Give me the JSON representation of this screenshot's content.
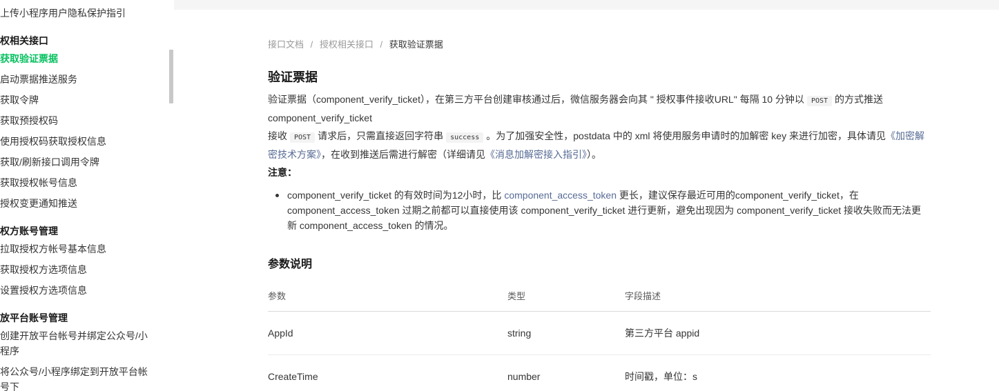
{
  "sidebar": {
    "items": [
      {
        "label": "上传小程序用户隐私保护指引",
        "kind": "item"
      },
      {
        "label": "权相关接口",
        "kind": "head"
      },
      {
        "label": "获取验证票据",
        "kind": "active"
      },
      {
        "label": "启动票据推送服务",
        "kind": "item"
      },
      {
        "label": "获取令牌",
        "kind": "item"
      },
      {
        "label": "获取预授权码",
        "kind": "item"
      },
      {
        "label": "使用授权码获取授权信息",
        "kind": "item"
      },
      {
        "label": "获取/刷新接口调用令牌",
        "kind": "item"
      },
      {
        "label": "获取授权帐号信息",
        "kind": "item"
      },
      {
        "label": "授权变更通知推送",
        "kind": "item"
      },
      {
        "label": "权方账号管理",
        "kind": "head"
      },
      {
        "label": "拉取授权方帐号基本信息",
        "kind": "item"
      },
      {
        "label": "获取授权方选项信息",
        "kind": "item"
      },
      {
        "label": "设置授权方选项信息",
        "kind": "item"
      },
      {
        "label": "放平台账号管理",
        "kind": "head"
      },
      {
        "label": "创建开放平台帐号并绑定公众号/小程序",
        "kind": "item"
      },
      {
        "label": "将公众号/小程序绑定到开放平台帐号下",
        "kind": "item"
      }
    ]
  },
  "breadcrumb": {
    "items": [
      "接口文档",
      "授权相关接口"
    ],
    "separator": "/",
    "current": "获取验证票据"
  },
  "main": {
    "title": "验证票据",
    "p1": {
      "a": "验证票据（component_verify_ticket），在第三方平台创建审核通过后，微信服务器会向其 \" 授权事件接收URL\" 每隔 10 分钟以",
      "code": "POST",
      "b": "的方式推送 component_verify_ticket"
    },
    "p2": {
      "a": "接收",
      "code1": "POST",
      "b": "请求后，只需直接返回字符串",
      "code2": "success",
      "c": "。为了加强安全性，postdata 中的 xml 将使用服务申请时的加解密 key 来进行加密，具体请见",
      "link1": "《加密解密技术方案》",
      "d": "，在收到推送后需进行解密（详细请见",
      "link2": "《消息加解密接入指引》",
      "e": "）。"
    },
    "note_label": "注意：",
    "bullet": {
      "a": "component_verify_ticket 的有效时间为12小时，比",
      "link": "component_access_token",
      "b": "更长，建议保存最近可用的component_verify_ticket，在 component_access_token 过期之前都可以直接使用该 component_verify_ticket 进行更新，避免出现因为 component_verify_ticket 接收失败而无法更新 component_access_token 的情况。"
    },
    "params_title": "参数说明",
    "table": {
      "headers": [
        "参数",
        "类型",
        "字段描述"
      ],
      "rows": [
        [
          "AppId",
          "string",
          "第三方平台 appid"
        ],
        [
          "CreateTime",
          "number",
          "时间戳，单位：s"
        ]
      ]
    }
  },
  "colors": {
    "accent": "#07c160",
    "link": "#576b95",
    "text": "#353535"
  }
}
